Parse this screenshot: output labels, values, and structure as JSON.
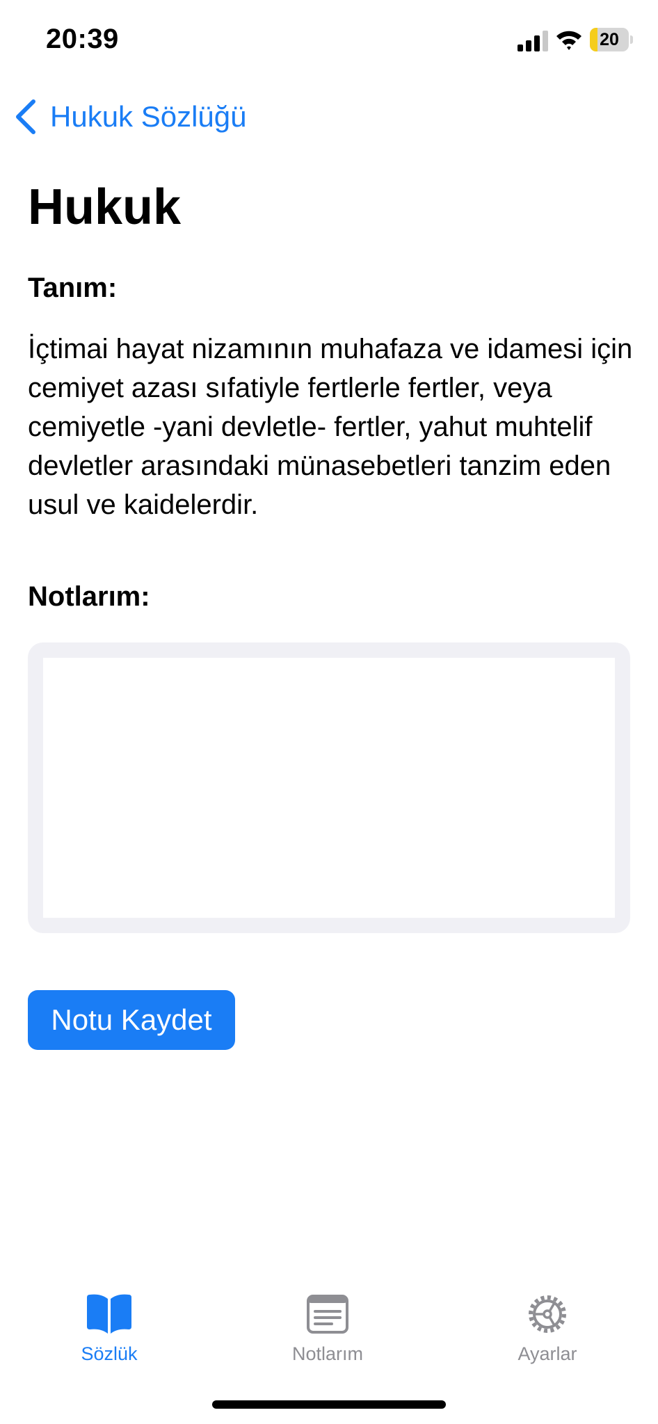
{
  "status_bar": {
    "time": "20:39",
    "battery_level": "20",
    "battery_fraction": 0.2,
    "icons": [
      "signal-icon",
      "wifi-icon",
      "battery-icon"
    ]
  },
  "nav": {
    "back_label": "Hukuk Sözlüğü",
    "back_icon": "chevron-left-icon"
  },
  "term": {
    "title": "Hukuk",
    "definition_label": "Tanım:",
    "definition": "İçtimai hayat nizamının muhafaza ve idamesi için cemiyet azası sıfatiyle fertlerle fertler, veya cemiyetle -yani devletle- fertler, yahut muhtelif devletler arasındaki münasebetleri tanzim eden usul ve kaidelerdir."
  },
  "notes": {
    "label": "Notlarım:",
    "value": "",
    "save_label": "Notu Kaydet"
  },
  "tab_bar": {
    "items": [
      {
        "label": "Sözlük",
        "icon": "book-icon",
        "active": true
      },
      {
        "label": "Notlarım",
        "icon": "notes-icon",
        "active": false
      },
      {
        "label": "Ayarlar",
        "icon": "gear-icon",
        "active": false
      }
    ]
  },
  "colors": {
    "accent": "#1a7df5",
    "inactive": "#8e8e93",
    "notes_background": "#f0f0f5",
    "battery_low": "#f5cd1c"
  }
}
